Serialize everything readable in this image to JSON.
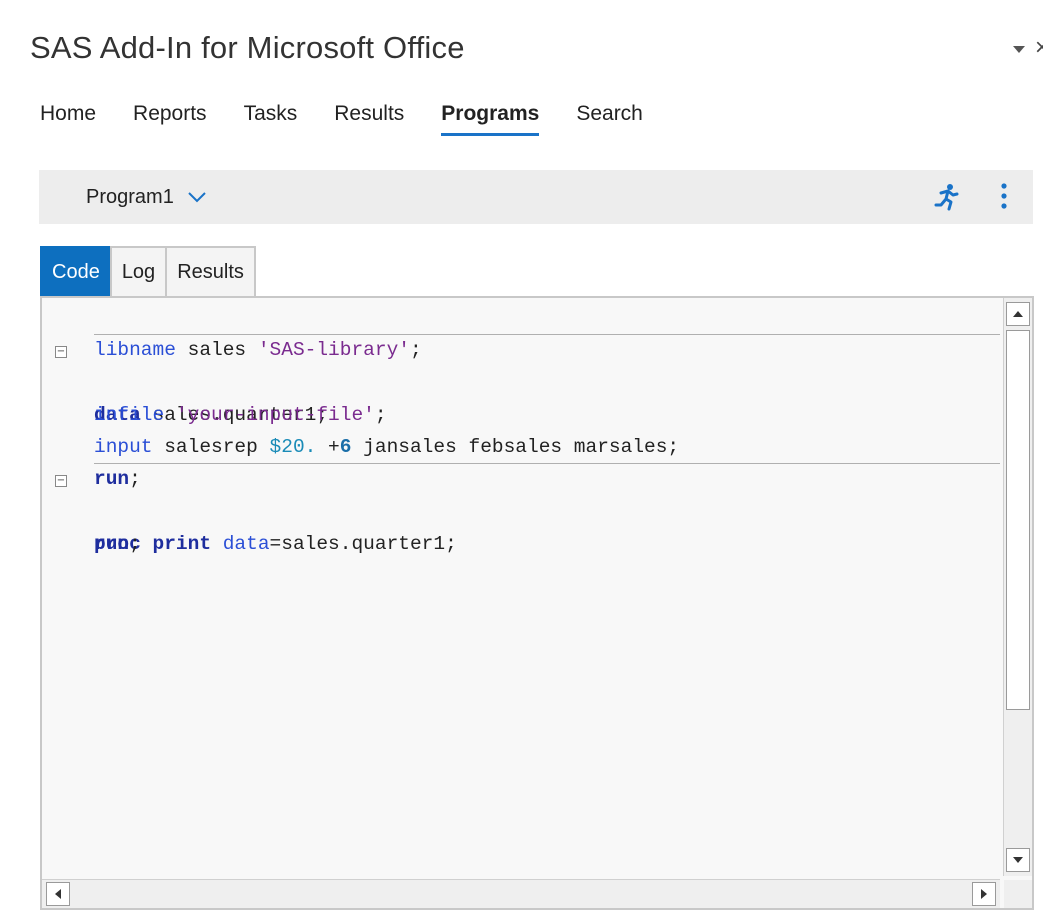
{
  "pane": {
    "title": "SAS Add-In for Microsoft Office",
    "dropdown_icon": "triangle-down-icon",
    "close_label": "×"
  },
  "nav": {
    "tabs": [
      {
        "label": "Home",
        "active": false
      },
      {
        "label": "Reports",
        "active": false
      },
      {
        "label": "Tasks",
        "active": false
      },
      {
        "label": "Results",
        "active": false
      },
      {
        "label": "Programs",
        "active": true
      },
      {
        "label": "Search",
        "active": false
      }
    ]
  },
  "program": {
    "name": "Program1",
    "run_icon": "running-person-icon",
    "more_icon": "vertical-ellipsis-icon"
  },
  "editor": {
    "tabs": [
      {
        "label": "Code",
        "active": true
      },
      {
        "label": "Log",
        "active": false
      },
      {
        "label": "Results",
        "active": false
      }
    ],
    "lines": {
      "l1": {
        "a": "libname",
        "b": " sales ",
        "c": "'SAS-library'",
        "d": ";"
      },
      "l2": {
        "a": "data",
        "b": " sales.quarter1;"
      },
      "l3": {
        "a": "infile",
        "b": " ",
        "c": "'your-input-file'",
        "d": ";"
      },
      "l4": {
        "a": "input",
        "b": " salesrep ",
        "c": "$20.",
        "d": " +",
        "e": "6",
        "f": " jansales febsales marsales;"
      },
      "l5": {
        "a": "run",
        "b": ";"
      },
      "l6": {
        "a": "proc print",
        "b": " ",
        "c": "data",
        "d": "=sales.quarter1;"
      },
      "l7": {
        "a": "run",
        "b": ";"
      }
    },
    "fold_glyph": "−"
  },
  "colors": {
    "accent": "#0d6fbf",
    "keyword": "#1f2e9e",
    "string": "#7a2b8f"
  }
}
